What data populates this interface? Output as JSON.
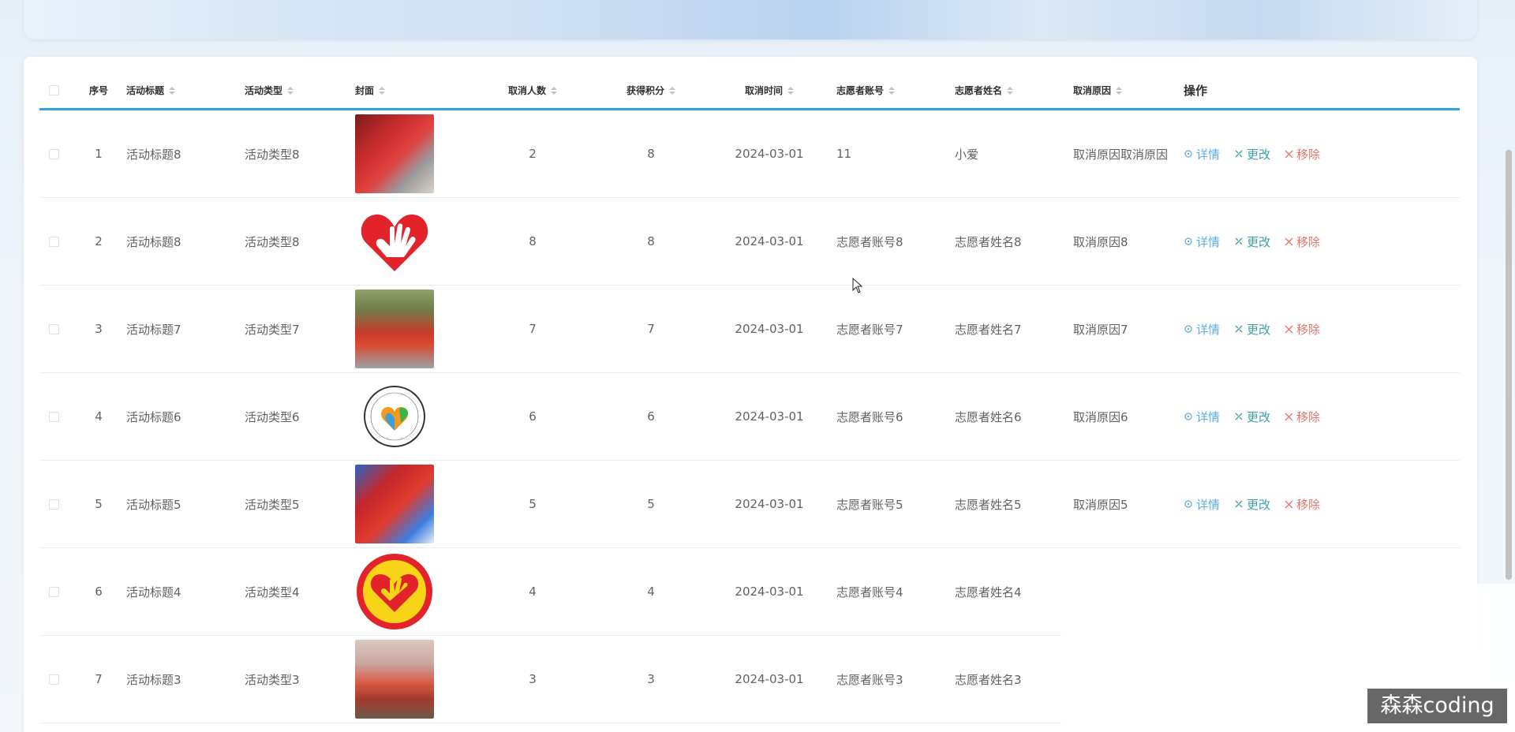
{
  "header": {
    "columns": [
      "序号",
      "活动标题",
      "活动类型",
      "封面",
      "取消人数",
      "获得积分",
      "取消时间",
      "志愿者账号",
      "志愿者姓名",
      "取消原因",
      "操作"
    ]
  },
  "actions": {
    "detail": "详情",
    "edit": "更改",
    "delete": "移除"
  },
  "rows": [
    {
      "idx": "1",
      "title": "活动标题8",
      "type": "活动类型8",
      "cover": "photo-volunteers-red-vests",
      "count": "2",
      "points": "8",
      "time": "2024-03-01",
      "account": "11",
      "name": "小爱",
      "reason": "取消原因取消原因"
    },
    {
      "idx": "2",
      "title": "活动标题8",
      "type": "活动类型8",
      "cover": "heart-hand-logo",
      "count": "8",
      "points": "8",
      "time": "2024-03-01",
      "account": "志愿者账号8",
      "name": "志愿者姓名8",
      "reason": "取消原因8"
    },
    {
      "idx": "3",
      "title": "活动标题7",
      "type": "活动类型7",
      "cover": "photo-group-banner",
      "count": "7",
      "points": "7",
      "time": "2024-03-01",
      "account": "志愿者账号7",
      "name": "志愿者姓名7",
      "reason": "取消原因7"
    },
    {
      "idx": "4",
      "title": "活动标题6",
      "type": "活动类型6",
      "cover": "circle-volunteer-badge",
      "count": "6",
      "points": "6",
      "time": "2024-03-01",
      "account": "志愿者账号6",
      "name": "志愿者姓名6",
      "reason": "取消原因6"
    },
    {
      "idx": "5",
      "title": "活动标题5",
      "type": "活动类型5",
      "cover": "photo-flags-event",
      "count": "5",
      "points": "5",
      "time": "2024-03-01",
      "account": "志愿者账号5",
      "name": "志愿者姓名5",
      "reason": "取消原因5"
    },
    {
      "idx": "6",
      "title": "活动标题4",
      "type": "活动类型4",
      "cover": "yellow-heart-badge",
      "count": "4",
      "points": "4",
      "time": "2024-03-01",
      "account": "志愿者账号4",
      "name": "志愿者姓名4",
      "reason": ""
    },
    {
      "idx": "7",
      "title": "活动标题3",
      "type": "活动类型3",
      "cover": "photo-crowd-banner",
      "count": "3",
      "points": "3",
      "time": "2024-03-01",
      "account": "志愿者账号3",
      "name": "志愿者姓名3",
      "reason": ""
    }
  ],
  "watermark": "森森coding",
  "colors": {
    "accent": "#2fa3e0",
    "detail": "#5aaee0",
    "edit": "#3fa0a8",
    "delete": "#e4756b"
  }
}
